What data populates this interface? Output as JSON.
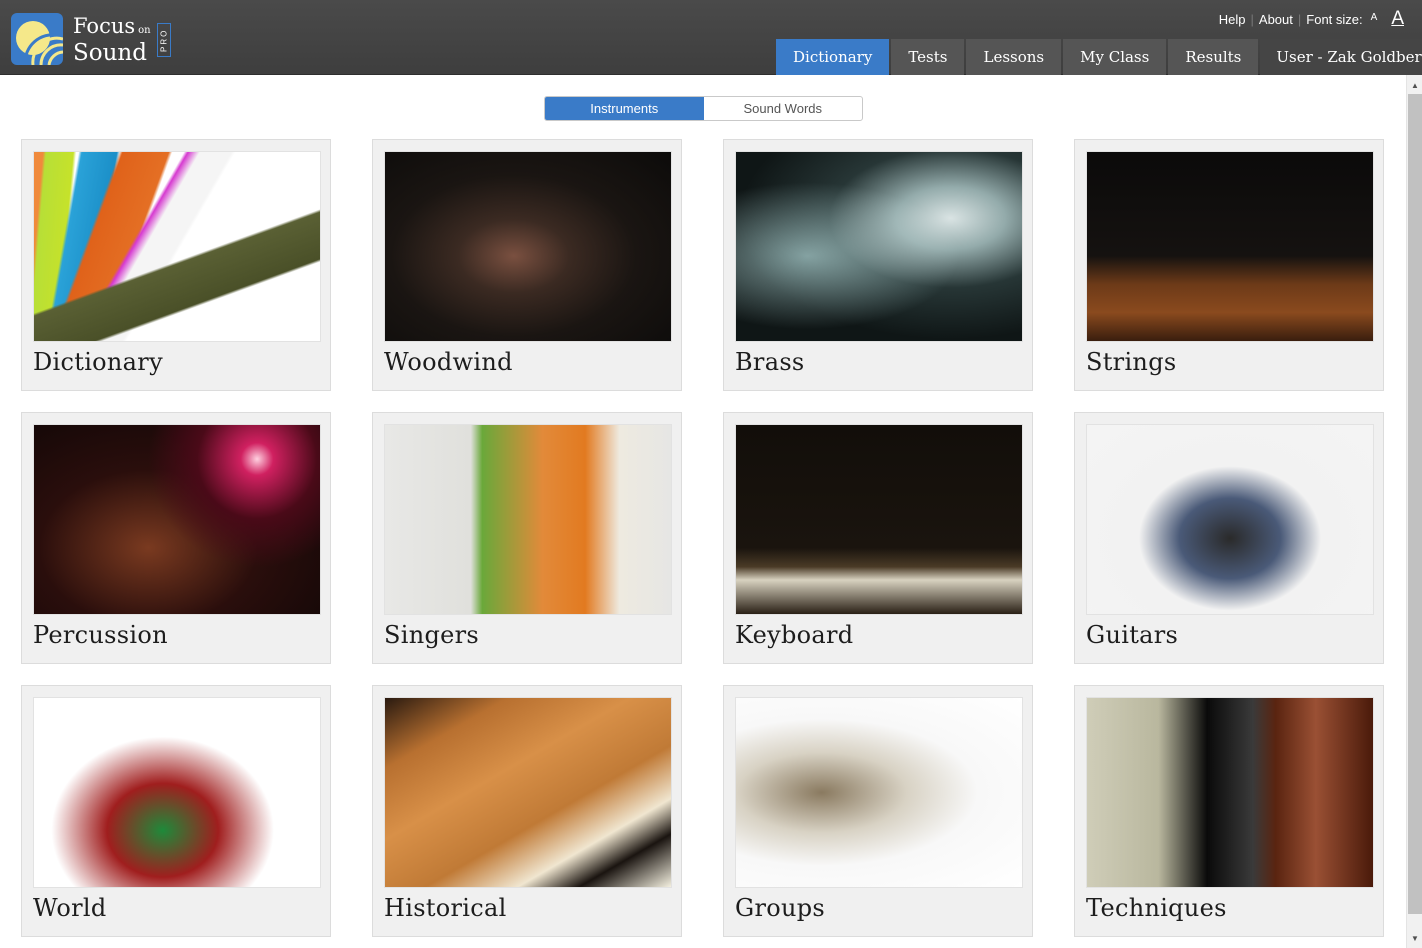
{
  "app": {
    "logo_line1": "Focus",
    "logo_on": "on",
    "logo_line2": "Sound",
    "logo_badge": "PRO",
    "brand_color": "#3a7bc8"
  },
  "utility": {
    "help": "Help",
    "about": "About",
    "font_size_label": "Font size:",
    "font_small": "A",
    "font_large": "A"
  },
  "nav": {
    "tabs": [
      {
        "label": "Dictionary",
        "active": true
      },
      {
        "label": "Tests",
        "active": false
      },
      {
        "label": "Lessons",
        "active": false
      },
      {
        "label": "My Class",
        "active": false
      },
      {
        "label": "Results",
        "active": false
      }
    ],
    "user_label": "User - Zak Goldberg"
  },
  "toggle": {
    "options": [
      {
        "label": "Instruments",
        "active": true
      },
      {
        "label": "Sound Words",
        "active": false
      }
    ]
  },
  "categories": [
    {
      "label": "Dictionary",
      "image": "stack-of-colorful-books"
    },
    {
      "label": "Woodwind",
      "image": "man-playing-flute"
    },
    {
      "label": "Brass",
      "image": "man-playing-flugelhorn"
    },
    {
      "label": "Strings",
      "image": "woman-playing-violin"
    },
    {
      "label": "Percussion",
      "image": "drum-kit-cymbals"
    },
    {
      "label": "Singers",
      "image": "group-of-singers-in-winter-hats"
    },
    {
      "label": "Keyboard",
      "image": "man-playing-piano"
    },
    {
      "label": "Guitars",
      "image": "man-playing-electric-guitar"
    },
    {
      "label": "World",
      "image": "woman-with-tanpura"
    },
    {
      "label": "Historical",
      "image": "harpsichord"
    },
    {
      "label": "Groups",
      "image": "band-with-singer"
    },
    {
      "label": "Techniques",
      "image": "hand-on-double-bass"
    }
  ],
  "scrollbar": {
    "up": "▲",
    "down": "▼"
  }
}
